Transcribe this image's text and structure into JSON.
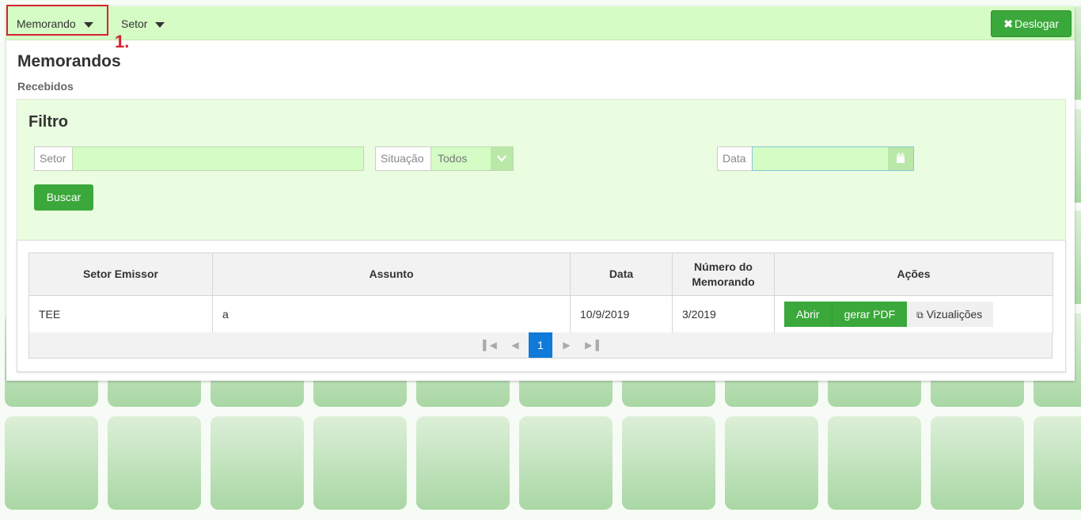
{
  "nav": {
    "memorando_label": "Memorando",
    "setor_label": "Setor",
    "logout_label": "Deslogar",
    "annotation": "1."
  },
  "page": {
    "title": "Memorandos",
    "subtitle": "Recebidos"
  },
  "filter": {
    "title": "Filtro",
    "setor_label": "Setor",
    "setor_value": "",
    "situacao_label": "Situação",
    "situacao_selected": "Todos",
    "data_label": "Data",
    "data_value": "",
    "search_label": "Buscar"
  },
  "table": {
    "headers": [
      "Setor Emissor",
      "Assunto",
      "Data",
      "Número do Memorando",
      "Ações"
    ],
    "rows": [
      {
        "setor_emissor": "TEE",
        "assunto": "a",
        "data": "10/9/2019",
        "numero": "3/2019"
      }
    ],
    "actions": {
      "open_label": "Abrir",
      "pdf_label": "gerar PDF",
      "views_label": "Vizualições"
    }
  },
  "pagination": {
    "current_page": "1",
    "first_icon": "first-page-icon",
    "prev_icon": "previous-page-icon",
    "next_icon": "next-page-icon",
    "last_icon": "last-page-icon"
  },
  "colors": {
    "navbar_bg": "#d4fcc4",
    "primary_green": "#3aa83a",
    "filter_bg": "#eafde0",
    "highlight_red": "#d4242b",
    "page_active": "#0f7ad8"
  }
}
